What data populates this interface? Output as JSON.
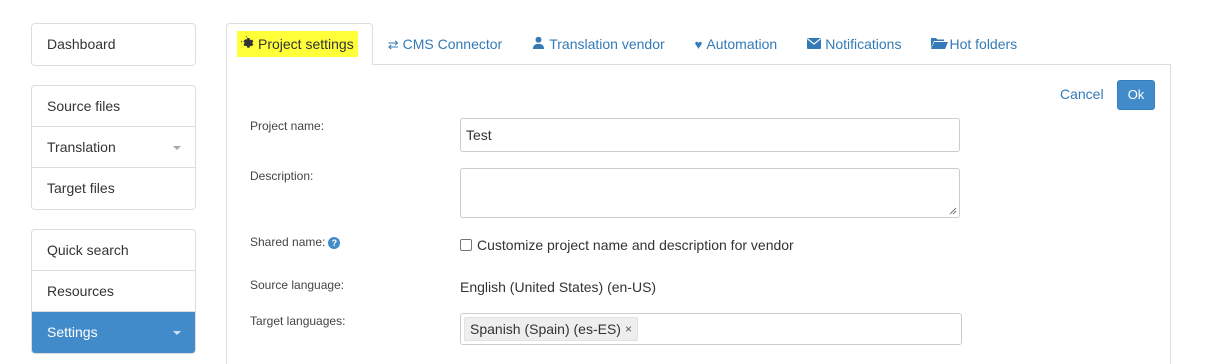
{
  "sidebar": {
    "groups": [
      {
        "items": [
          {
            "label": "Dashboard"
          }
        ]
      },
      {
        "items": [
          {
            "label": "Source files"
          },
          {
            "label": "Translation",
            "has_caret": true
          },
          {
            "label": "Target files"
          }
        ]
      },
      {
        "items": [
          {
            "label": "Quick search"
          },
          {
            "label": "Resources"
          },
          {
            "label": "Settings",
            "active": true,
            "has_caret": true
          }
        ]
      }
    ]
  },
  "tabs": [
    {
      "label": "Project settings",
      "icon": "gear-icon",
      "active": true,
      "highlighted": true
    },
    {
      "label": "CMS Connector",
      "icon": "swap-arrows-icon"
    },
    {
      "label": "Translation vendor",
      "icon": "user-icon"
    },
    {
      "label": "Automation",
      "icon": "heart-icon"
    },
    {
      "label": "Notifications",
      "icon": "envelope-icon"
    },
    {
      "label": "Hot folders",
      "icon": "folder-open-icon"
    }
  ],
  "actions": {
    "cancel_label": "Cancel",
    "ok_label": "Ok"
  },
  "form": {
    "project_name_label": "Project name:",
    "project_name_value": "Test",
    "description_label": "Description:",
    "description_value": "",
    "shared_name_label": "Shared name:",
    "help_icon_glyph": "?",
    "customize_label": "Customize project name and description for vendor",
    "customize_checked": false,
    "source_language_label": "Source language:",
    "source_language_value": "English (United States) (en-US)",
    "target_languages_label": "Target languages:",
    "target_languages": [
      {
        "label": "Spanish (Spain) (es-ES)",
        "remove_glyph": "×"
      }
    ]
  },
  "colors": {
    "accent": "#428bca",
    "link": "#337ab7",
    "highlight": "#ffff3a",
    "border": "#dddddd"
  }
}
